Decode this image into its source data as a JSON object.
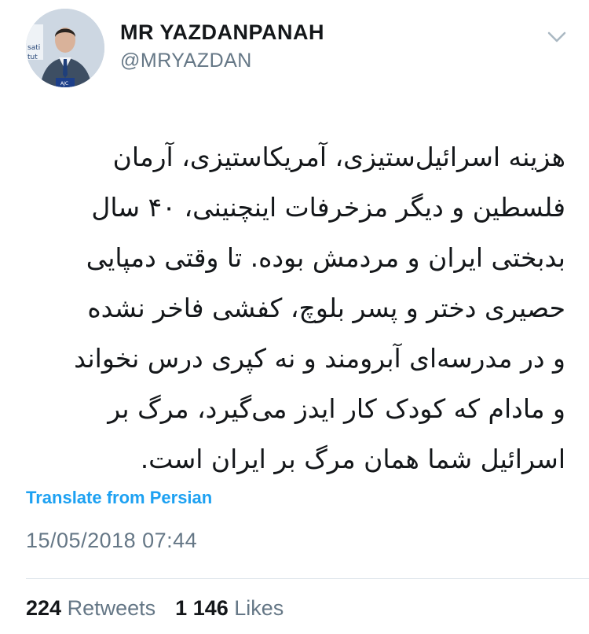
{
  "user": {
    "display_name": "MR YAZDANPANAH",
    "handle": "@MRYAZDAN",
    "avatar_icon": "profile-photo",
    "avatar_badge": "AJC"
  },
  "menu": {
    "icon": "chevron-down-icon"
  },
  "tweet": {
    "lines": [
      "هزینه اسرائیل‌ستیزی، آمریکاستیزی، آرمان",
      "فلسطین و دیگر مزخرفات اینچنینی، ۴۰ سال",
      "بدبختی ایران و مردمش بوده. تا وقتی دمپایی",
      "حصیری دختر و پسر بلوچ، کفشی فاخر نشده",
      "و در مدرسه‌ای آبرومند و نه کپری درس نخواند",
      "و مادام که کودک کار ایدز می‌گیرد، مرگ بر",
      "اسرائیل شما همان مرگ بر ایران است."
    ],
    "translate_label": "Translate from Persian",
    "timestamp": "15/05/2018 07:44"
  },
  "stats": {
    "retweets_count": "224",
    "retweets_label": "Retweets",
    "likes_count": "1 146",
    "likes_label": "Likes"
  },
  "colors": {
    "link": "#1da1f2",
    "muted": "#657786",
    "text": "#14171a",
    "divider": "#e1e8ed"
  }
}
